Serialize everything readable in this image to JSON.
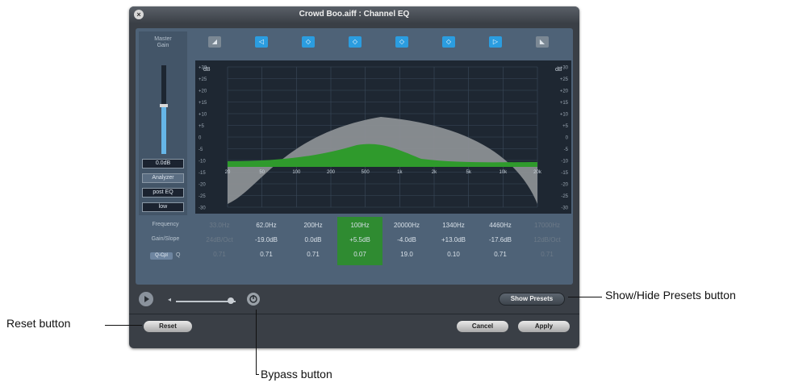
{
  "window": {
    "title": "Crowd Boo.aiff : Channel EQ",
    "close_glyph": "×"
  },
  "master": {
    "label_line1": "Master",
    "label_line2": "Gain",
    "gain_value": "0.0dB",
    "fader_level": 0.55,
    "analyzer_label": "Analyzer",
    "post_eq_label": "post EQ",
    "resolution_label": "low"
  },
  "bands": [
    {
      "name": "lowcut",
      "icon": "lowcut-icon",
      "active": false
    },
    {
      "name": "lowshelf",
      "icon": "low-shelf-icon",
      "active": true
    },
    {
      "name": "bell1",
      "icon": "bell-icon",
      "active": true
    },
    {
      "name": "bell2",
      "icon": "bell-icon",
      "active": true
    },
    {
      "name": "bell3",
      "icon": "bell-icon",
      "active": true
    },
    {
      "name": "bell4",
      "icon": "bell-icon",
      "active": true
    },
    {
      "name": "highshelf",
      "icon": "high-shelf-icon",
      "active": true
    },
    {
      "name": "highcut",
      "icon": "highcut-icon",
      "active": false
    }
  ],
  "graph": {
    "db_unit": "dB",
    "db_ticks": [
      "+30",
      "+25",
      "+20",
      "+15",
      "+10",
      "+5",
      "0",
      "-5",
      "-10",
      "-15",
      "-20",
      "-25",
      "-30"
    ],
    "freq_ticks": [
      "20",
      "50",
      "100",
      "200",
      "500",
      "1k",
      "2k",
      "5k",
      "10k",
      "20k"
    ],
    "colors": {
      "background": "#1e2732",
      "grid": "#3b4a5a",
      "grey_curve": "#8b8f93",
      "green_curve": "#2f9a2c"
    }
  },
  "params": {
    "row_labels": [
      "Frequency",
      "Gain/Slope",
      ""
    ],
    "q_couple_label": "Q-Cpl",
    "q_label": "Q",
    "columns": [
      {
        "frequency": "33.0Hz",
        "gain": "24dB/Oct",
        "q": "0.71",
        "dim": true
      },
      {
        "frequency": "62.0Hz",
        "gain": "-19.0dB",
        "q": "0.71",
        "dim": false
      },
      {
        "frequency": "200Hz",
        "gain": "0.0dB",
        "q": "0.71",
        "dim": false
      },
      {
        "frequency": "100Hz",
        "gain": "+5.5dB",
        "q": "0.07",
        "dim": false,
        "selected": true
      },
      {
        "frequency": "20000Hz",
        "gain": "-4.0dB",
        "q": "19.0",
        "dim": false
      },
      {
        "frequency": "1340Hz",
        "gain": "+13.0dB",
        "q": "0.10",
        "dim": false
      },
      {
        "frequency": "4460Hz",
        "gain": "-17.6dB",
        "q": "0.71",
        "dim": false
      },
      {
        "frequency": "17000Hz",
        "gain": "12dB/Oct",
        "q": "0.71",
        "dim": true
      }
    ]
  },
  "transport": {
    "play_icon": "play-icon",
    "volume_min_icon": "speaker-icon",
    "bypass_icon": "bypass-icon"
  },
  "buttons": {
    "show_presets": "Show Presets",
    "reset": "Reset",
    "cancel": "Cancel",
    "apply": "Apply"
  },
  "callouts": {
    "presets": "Show/Hide Presets button",
    "reset": "Reset button",
    "bypass": "Bypass button"
  }
}
